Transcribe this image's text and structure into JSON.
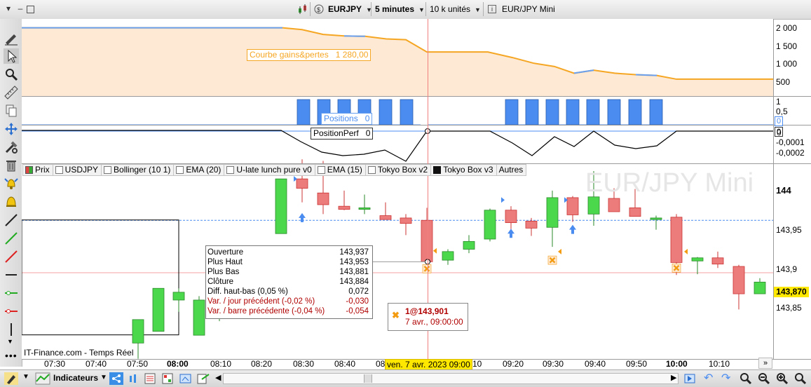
{
  "toolbar": {
    "symbol": "EURJPY",
    "timeframe": "5 minutes",
    "units": "10 k unités",
    "instrument": "EUR/JPY Mini"
  },
  "chart_title_watermark": "EUR/JPY Mini",
  "provider": "IT-Finance.com - Temps Réel",
  "pnl_panel": {
    "label": "Courbe gains&pertes",
    "value": "1 280,00",
    "yticks": [
      "2 000",
      "1 500",
      "1 000",
      "500"
    ]
  },
  "positions_panel": {
    "label": "Positions",
    "value": "0",
    "yticks": [
      "1",
      "0,5"
    ],
    "marker": "0"
  },
  "perf_panel": {
    "label": "PositionPerf",
    "value": "0",
    "yticks": [
      "0",
      "-0,0001",
      "-0,0002"
    ],
    "marker": "0"
  },
  "indicator_tabs": [
    {
      "label": "Prix",
      "check": "price"
    },
    {
      "label": "USDJPY",
      "check": "empty"
    },
    {
      "label": "Bollinger (10 1)",
      "check": "empty"
    },
    {
      "label": "EMA (20)",
      "check": "empty"
    },
    {
      "label": "U-late lunch pure v0",
      "check": "empty"
    },
    {
      "label": "EMA (15)",
      "check": "empty"
    },
    {
      "label": "Tokyo Box v2",
      "check": "empty"
    },
    {
      "label": "Tokyo Box v3",
      "check": "fill"
    },
    {
      "label": "Autres",
      "check": "none"
    }
  ],
  "price_axis": {
    "ticks": [
      "144",
      "143,95",
      "143,9",
      "143,85"
    ],
    "current_price": "143,870",
    "current_color": "#ffe800"
  },
  "time_axis": {
    "ticks": [
      "07:30",
      "07:40",
      "07:50",
      "08:00",
      "08:10",
      "08:20",
      "08:30",
      "08:40",
      "08",
      "10",
      "09:20",
      "09:30",
      "09:40",
      "09:50",
      "10:00",
      "10:10"
    ],
    "cursor_label": "ven. 7 avr. 2023 09:00"
  },
  "infobox": {
    "rows": [
      {
        "label": "Ouverture",
        "value": "143,937",
        "red": false
      },
      {
        "label": "Plus Haut",
        "value": "143,953",
        "red": false
      },
      {
        "label": "Plus Bas",
        "value": "143,881",
        "red": false
      },
      {
        "label": "Clôture",
        "value": "143,884",
        "red": false
      },
      {
        "label": "Diff. haut-bas (0,05 %)",
        "value": "0,072",
        "red": false
      },
      {
        "label": "Var. / jour précédent (-0,02 %)",
        "value": "-0,030",
        "red": true
      },
      {
        "label": "Var. / barre précédente (-0,04 %)",
        "value": "-0,054",
        "red": true
      }
    ]
  },
  "trade_tooltip": {
    "title": "1@143,901",
    "subtitle": "7 avr., 09:00:00"
  },
  "bottom_toolbar": {
    "indicators_label": "Indicateurs"
  },
  "colors": {
    "bull": "#4cd84c",
    "bear": "#ec7b7b",
    "pnl_line": "#f5a623",
    "pnl_fill": "#fde9d4",
    "position_bar": "#4a8cf0",
    "cursor": "#f08080"
  },
  "chart_data": {
    "type": "candlestick",
    "title": "EUR/JPY Mini",
    "x": [
      "07:50",
      "07:55",
      "08:00",
      "08:05",
      "08:10",
      "08:15",
      "08:20",
      "08:25",
      "08:30",
      "08:35",
      "08:40",
      "08:45",
      "08:50",
      "08:55",
      "09:00",
      "09:05",
      "09:10",
      "09:15",
      "09:20",
      "09:25",
      "09:30",
      "09:35",
      "09:40",
      "09:45",
      "09:50",
      "09:55",
      "10:00",
      "10:05",
      "10:10",
      "10:15",
      "10:20"
    ],
    "series": [
      {
        "name": "Prix",
        "ohlc": [
          [
            143.78,
            143.81,
            143.76,
            143.81
          ],
          [
            143.795,
            143.85,
            143.795,
            143.85
          ],
          [
            143.835,
            143.85,
            143.82,
            143.845
          ],
          [
            143.79,
            143.84,
            143.79,
            143.835
          ],
          [
            143.82,
            143.86,
            143.808,
            143.85
          ],
          [
            143.856,
            143.866,
            143.856,
            143.866
          ],
          [
            143.87,
            143.88,
            143.86,
            143.875
          ],
          [
            143.92,
            143.99,
            143.92,
            143.99
          ],
          [
            143.99,
            144.015,
            143.96,
            143.978
          ],
          [
            143.972,
            144.013,
            143.945,
            143.957
          ],
          [
            143.955,
            143.975,
            143.95,
            143.951
          ],
          [
            143.951,
            143.97,
            143.945,
            143.953
          ],
          [
            143.943,
            143.96,
            143.938,
            143.938
          ],
          [
            143.94,
            143.945,
            143.918,
            143.933
          ],
          [
            143.937,
            143.953,
            143.881,
            143.884
          ],
          [
            143.886,
            143.9,
            143.88,
            143.897
          ],
          [
            143.9,
            143.918,
            143.895,
            143.91
          ],
          [
            143.913,
            143.952,
            143.91,
            143.95
          ],
          [
            143.95,
            143.955,
            143.92,
            143.934
          ],
          [
            143.936,
            143.94,
            143.917,
            143.927
          ],
          [
            143.928,
            143.975,
            143.903,
            143.966
          ],
          [
            143.966,
            143.968,
            143.935,
            143.944
          ],
          [
            143.945,
            144.0,
            143.93,
            143.967
          ],
          [
            143.965,
            143.978,
            143.948,
            143.948
          ],
          [
            143.953,
            143.977,
            143.942,
            143.942
          ],
          [
            143.938,
            143.943,
            143.925,
            143.94
          ],
          [
            143.941,
            143.945,
            143.867,
            143.883
          ],
          [
            143.885,
            143.89,
            143.868,
            143.889
          ],
          [
            143.889,
            143.897,
            143.876,
            143.881
          ],
          [
            143.878,
            143.88,
            143.823,
            143.843
          ],
          [
            143.843,
            143.863,
            143.843,
            143.858
          ]
        ]
      }
    ],
    "ylim": [
      143.78,
      144.02
    ]
  }
}
